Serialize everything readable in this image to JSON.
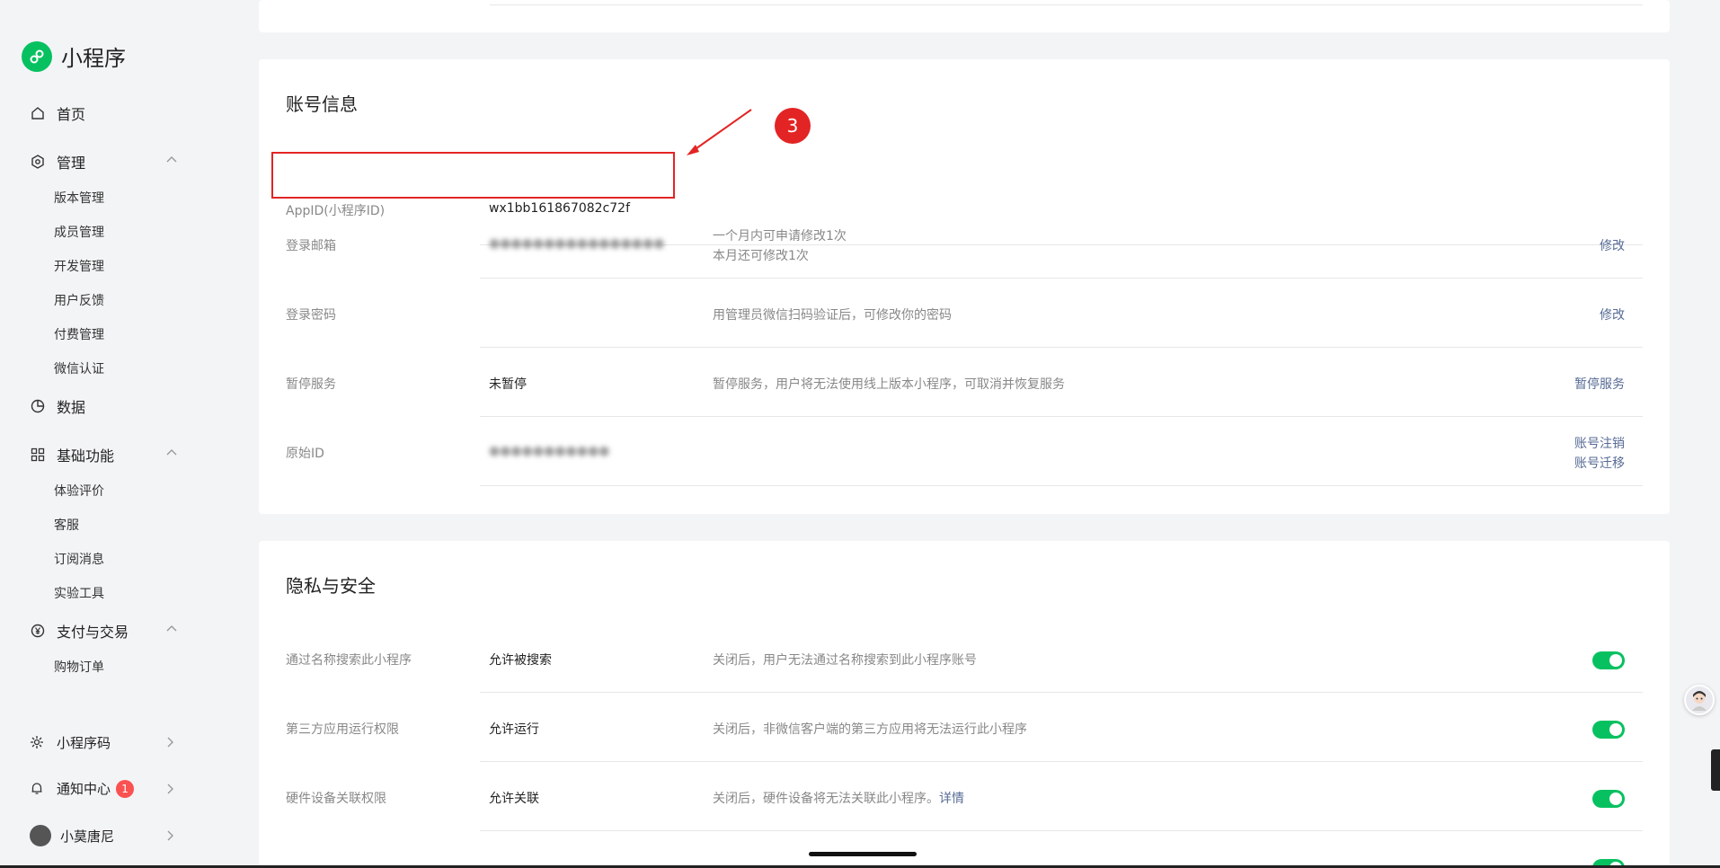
{
  "app": {
    "title": "小程序"
  },
  "sidebar": {
    "home": "首页",
    "manage": {
      "label": "管理",
      "items": [
        "版本管理",
        "成员管理",
        "开发管理",
        "用户反馈",
        "付费管理",
        "微信认证"
      ]
    },
    "data": "数据",
    "basic": {
      "label": "基础功能",
      "items": [
        "体验评价",
        "客服",
        "订阅消息",
        "实验工具"
      ]
    },
    "pay": {
      "label": "支付与交易",
      "items": [
        "购物订单"
      ]
    },
    "qrcode": "小程序码",
    "notify": {
      "label": "通知中心",
      "badge": "1"
    },
    "user": "小莫唐尼"
  },
  "account": {
    "title": "账号信息",
    "rows": [
      {
        "label": "AppID(小程序ID)",
        "value": "wx1bb161867082c72f",
        "desc": "",
        "action": ""
      },
      {
        "label": "登录邮箱",
        "value": "",
        "desc1": "一个月内可申请修改1次",
        "desc2": "本月还可修改1次",
        "action": "修改"
      },
      {
        "label": "登录密码",
        "value": "",
        "desc": "用管理员微信扫码验证后，可修改你的密码",
        "action": "修改"
      },
      {
        "label": "暂停服务",
        "value": "未暂停",
        "desc": "暂停服务，用户将无法使用线上版本小程序，可取消并恢复服务",
        "action": "暂停服务"
      },
      {
        "label": "原始ID",
        "value": "",
        "desc": "",
        "action1": "账号注销",
        "action2": "账号迁移"
      }
    ]
  },
  "privacy": {
    "title": "隐私与安全",
    "rows": [
      {
        "label": "通过名称搜索此小程序",
        "value": "允许被搜索",
        "desc": "关闭后，用户无法通过名称搜索到此小程序账号"
      },
      {
        "label": "第三方应用运行权限",
        "value": "允许运行",
        "desc": "关闭后，非微信客户端的第三方应用将无法运行此小程序"
      },
      {
        "label": "硬件设备关联权限",
        "value": "允许关联",
        "desc": "关闭后，硬件设备将无法关联此小程序。",
        "link": "详情"
      }
    ]
  },
  "annotation": {
    "step": "3"
  },
  "colors": {
    "accent": "#07c160",
    "link": "#576b95",
    "annotation": "#e32424"
  }
}
